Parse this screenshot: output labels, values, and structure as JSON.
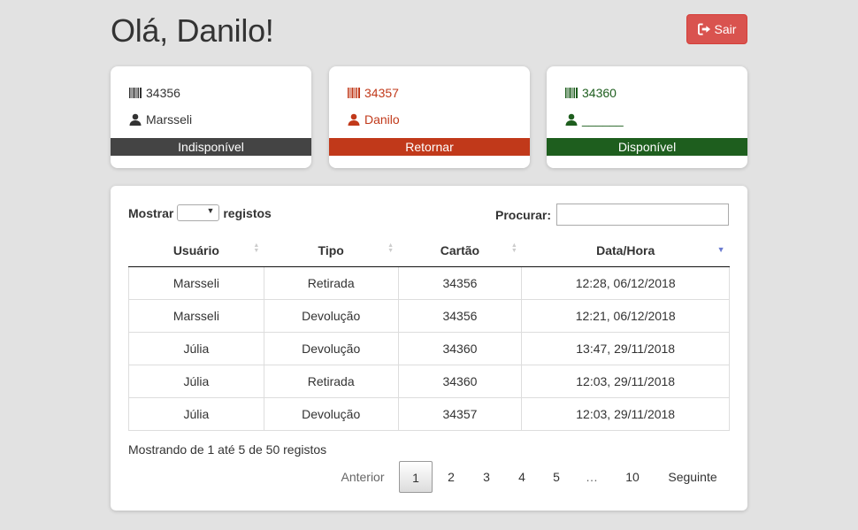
{
  "header": {
    "greeting": "Olá, Danilo!",
    "logout_label": "Sair"
  },
  "cards": [
    {
      "card_id": "34356",
      "user": "Marsseli",
      "status": "Indisponível",
      "text_color": "#333333",
      "status_color": "#444444"
    },
    {
      "card_id": "34357",
      "user": "Danilo",
      "status": "Retornar",
      "text_color": "#c1391a",
      "status_color": "#c1391a"
    },
    {
      "card_id": "34360",
      "user": "______",
      "status": "Disponível",
      "text_color": "#1e5e1e",
      "status_color": "#1e5e1e"
    }
  ],
  "table": {
    "length_pre": "Mostrar",
    "length_post": "registos",
    "search_label": "Procurar:",
    "search_value": "",
    "columns": [
      "Usuário",
      "Tipo",
      "Cartão",
      "Data/Hora"
    ],
    "rows": [
      [
        "Marsseli",
        "Retirada",
        "34356",
        "12:28, 06/12/2018"
      ],
      [
        "Marsseli",
        "Devolução",
        "34356",
        "12:21, 06/12/2018"
      ],
      [
        "Júlia",
        "Devolução",
        "34360",
        "13:47, 29/11/2018"
      ],
      [
        "Júlia",
        "Retirada",
        "34360",
        "12:03, 29/11/2018"
      ],
      [
        "Júlia",
        "Devolução",
        "34357",
        "12:03, 29/11/2018"
      ]
    ],
    "info": "Mostrando de 1 até 5 de 50 registos",
    "pagination": {
      "previous": "Anterior",
      "pages": [
        "1",
        "2",
        "3",
        "4",
        "5",
        "…",
        "10"
      ],
      "current": "1",
      "next": "Seguinte"
    }
  },
  "colors": {
    "background": "#e2e2e2",
    "logout": "#d9534f",
    "sort_active": "#6b7bd0"
  }
}
